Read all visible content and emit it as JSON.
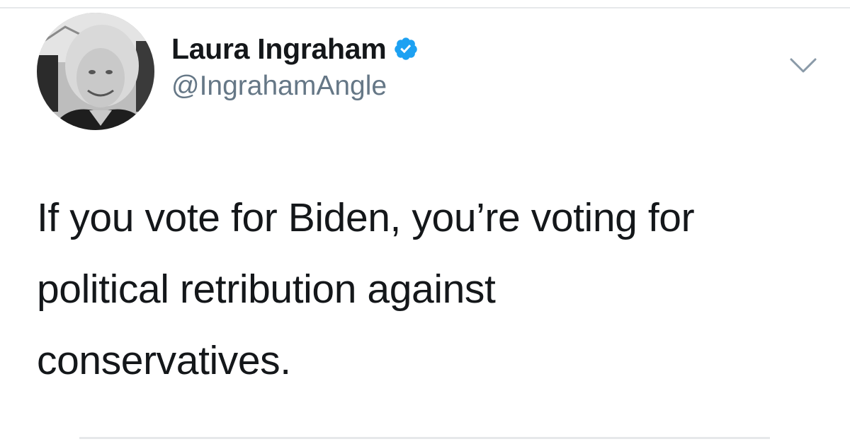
{
  "author": {
    "display_name": "Laura Ingraham",
    "handle": "@IngrahamAngle",
    "verified": true,
    "verified_color": "#1da1f2",
    "avatar_icon": "profile-photo"
  },
  "menu": {
    "icon": "chevron-down-icon"
  },
  "tweet": {
    "lines": [
      "If you vote for Biden, you’re voting for",
      "political retribution against",
      "conservatives."
    ]
  },
  "colors": {
    "text_primary": "#14171a",
    "text_secondary": "#657786",
    "divider": "#e6e8ea"
  }
}
